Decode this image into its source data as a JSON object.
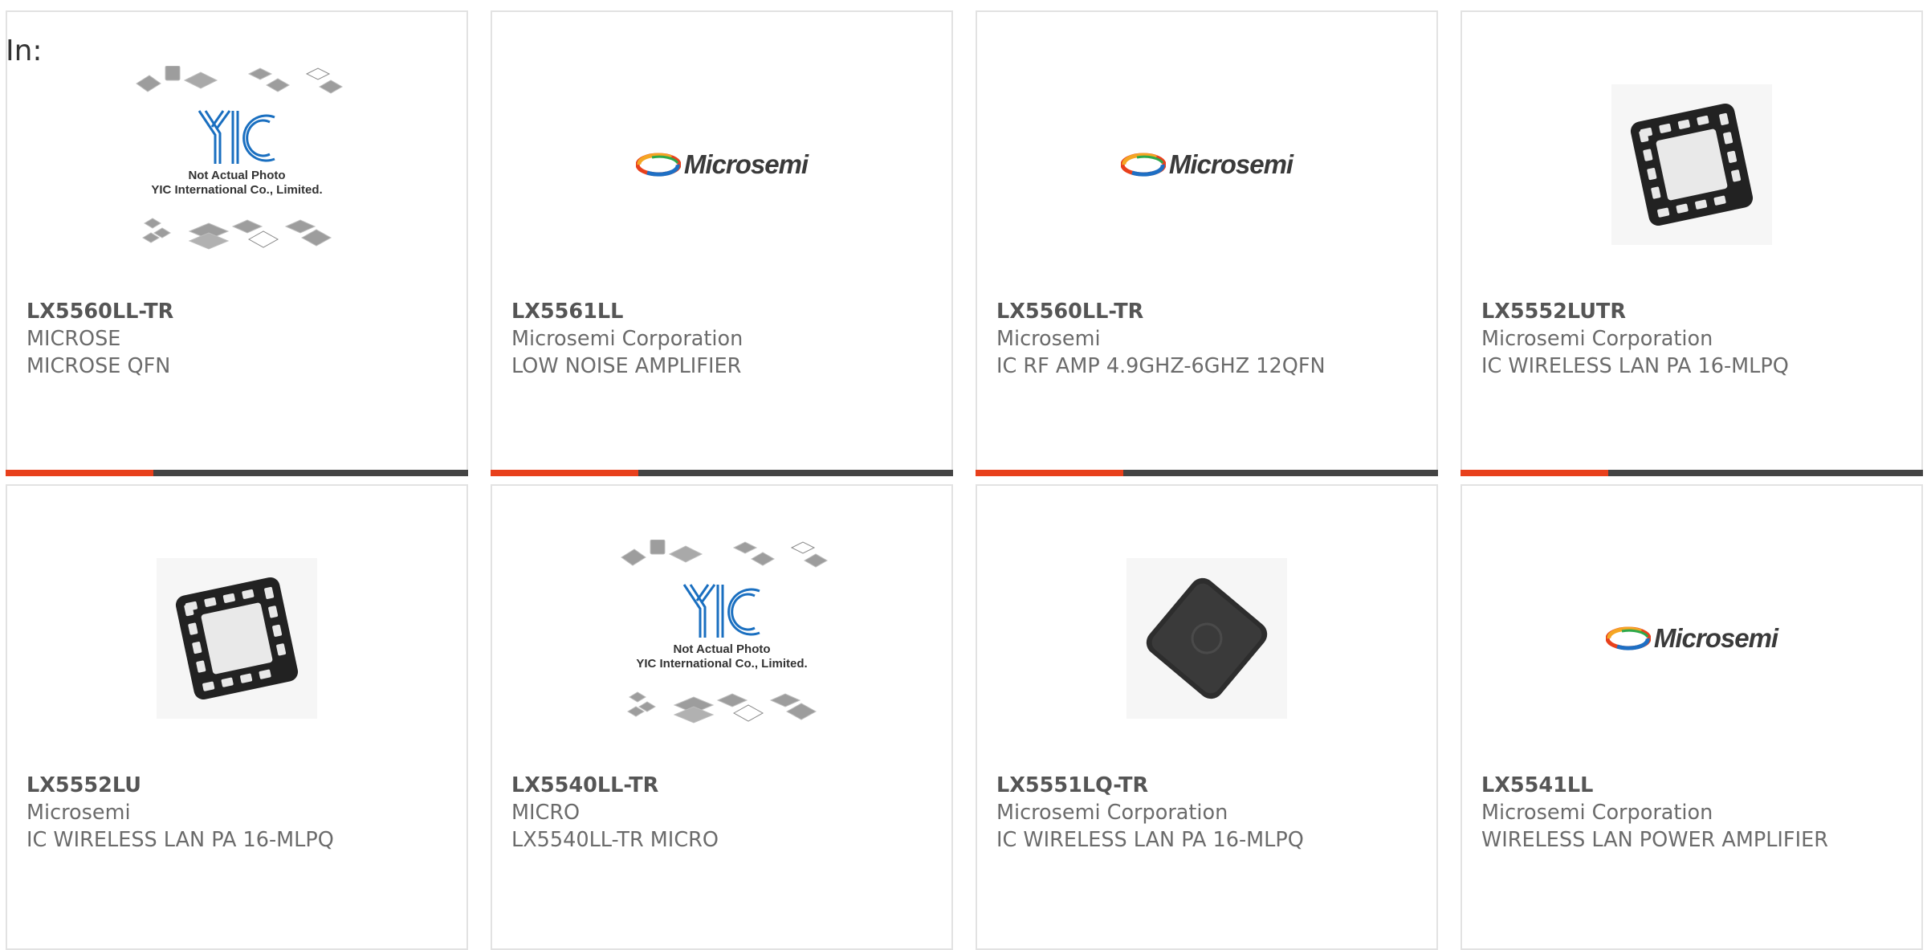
{
  "filter_label": "In:",
  "logo_text": "Microsemi",
  "placeholder_lines": [
    "Not Actual Photo",
    "YIC International Co., Limited."
  ],
  "accent_color": "#e8401c",
  "bar_color": "#444444",
  "products": [
    {
      "part": "LX5560LL-TR",
      "manufacturer": "MICROSE",
      "description": "MICROSE QFN",
      "image": "yic-placeholder"
    },
    {
      "part": "LX5561LL",
      "manufacturer": "Microsemi Corporation",
      "description": "LOW NOISE AMPLIFIER",
      "image": "microsemi-logo"
    },
    {
      "part": "LX5560LL-TR",
      "manufacturer": "Microsemi",
      "description": "IC RF AMP 4.9GHZ-6GHZ 12QFN",
      "image": "microsemi-logo"
    },
    {
      "part": "LX5552LUTR",
      "manufacturer": "Microsemi Corporation",
      "description": "IC WIRELESS LAN PA 16-MLPQ",
      "image": "qfn16-chip"
    },
    {
      "part": "LX5552LU",
      "manufacturer": "Microsemi",
      "description": "IC WIRELESS LAN PA 16-MLPQ",
      "image": "qfn16-chip"
    },
    {
      "part": "LX5540LL-TR",
      "manufacturer": "MICRO",
      "description": "LX5540LL-TR MICRO",
      "image": "yic-placeholder"
    },
    {
      "part": "LX5551LQ-TR",
      "manufacturer": "Microsemi Corporation",
      "description": "IC WIRELESS LAN PA 16-MLPQ",
      "image": "dfn-chip"
    },
    {
      "part": "LX5541LL",
      "manufacturer": "Microsemi Corporation",
      "description": "WIRELESS LAN POWER AMPLIFIER",
      "image": "microsemi-logo"
    }
  ]
}
